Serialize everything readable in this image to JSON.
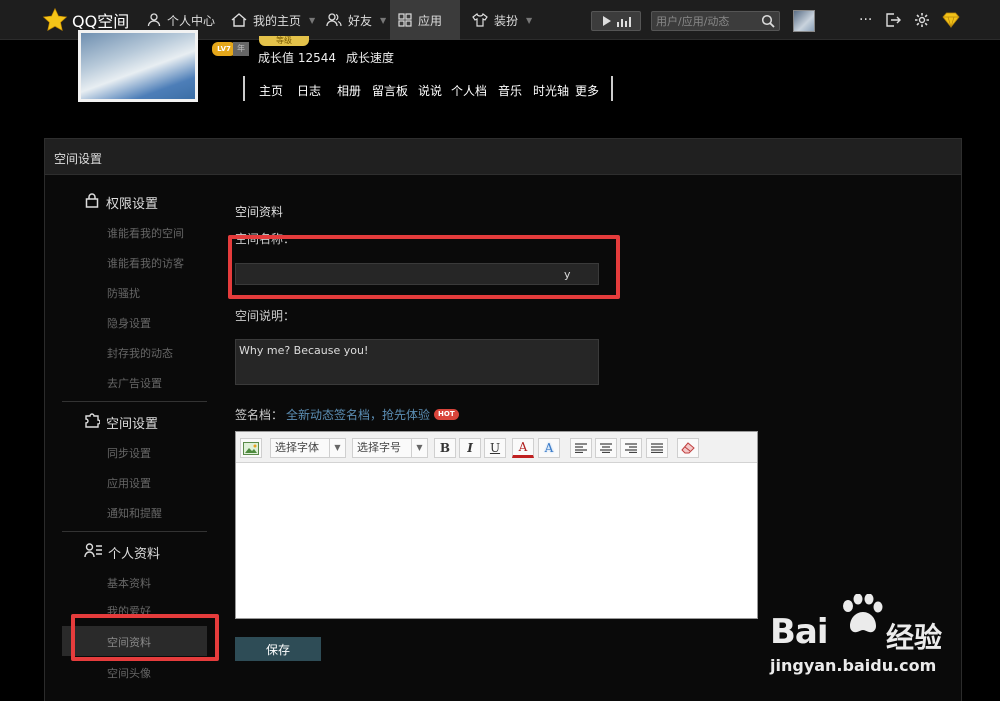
{
  "topbar": {
    "logo": "QQ空间",
    "nav": {
      "personal_center": "个人中心",
      "my_home": "我的主页",
      "friends": "好友",
      "apps": "应用",
      "decorate": "装扮"
    },
    "search_placeholder": "用户/应用/动态",
    "more": "···"
  },
  "profile": {
    "vip_badge_text": "等级",
    "level_badge": "LV7",
    "year_badge": "年",
    "growth_value": "成长值 12544",
    "growth_speed": "成长速度",
    "nav": [
      "主页",
      "日志",
      "相册",
      "留言板",
      "说说",
      "个人档",
      "音乐",
      "时光轴",
      "更多"
    ]
  },
  "settings": {
    "title": "空间设置",
    "sidebar": {
      "privacy": {
        "heading": "权限设置",
        "items": [
          "谁能看我的空间",
          "谁能看我的访客",
          "防骚扰",
          "隐身设置",
          "封存我的动态",
          "去广告设置"
        ]
      },
      "space": {
        "heading": "空间设置",
        "items": [
          "同步设置",
          "应用设置",
          "通知和提醒"
        ]
      },
      "profile": {
        "heading": "个人资料",
        "items": [
          "基本资料",
          "我的爱好",
          "空间资料",
          "空间头像"
        ]
      }
    },
    "form": {
      "section_title": "空间资料",
      "name_label": "空间名称：",
      "name_value": "y",
      "desc_label": "空间说明：",
      "desc_value": "Why me? Because you!",
      "sig_label": "签名档：",
      "sig_link": "全新动态签名档，抢先体验",
      "hot": "HOT",
      "font_select": "选择字体",
      "size_select": "选择字号",
      "bold": "B",
      "italic": "I",
      "underline": "U",
      "font_color": "A",
      "highlight": "A",
      "save": "保存"
    }
  },
  "watermark": {
    "brand": "Bai",
    "brand_cn": "经验",
    "url": "jingyan.baidu.com"
  },
  "colors": {
    "highlight_red": "#e53c3c",
    "save_button": "#2e4c56",
    "link": "#5b8db3",
    "hot": "#d9443a",
    "gold": "#e4c24a"
  }
}
